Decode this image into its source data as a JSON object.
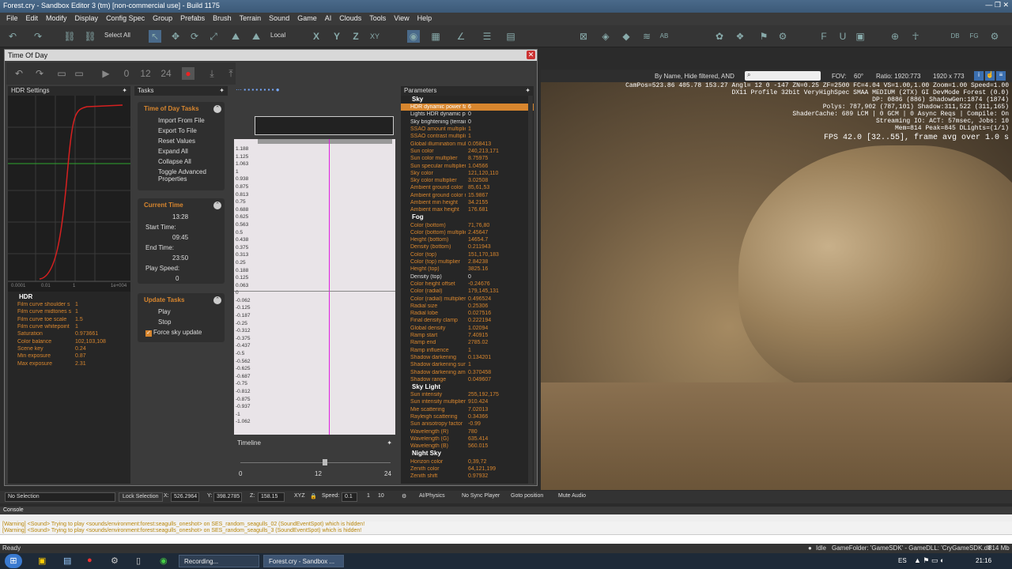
{
  "window": {
    "title": "Forest.cry - Sandbox Editor 3 (tm) [non-commercial use] - Build 1175"
  },
  "menu": [
    "File",
    "Edit",
    "Modify",
    "Display",
    "Config Spec",
    "Group",
    "Prefabs",
    "Brush",
    "Terrain",
    "Sound",
    "Game",
    "AI",
    "Clouds",
    "Tools",
    "View",
    "Help"
  ],
  "toolbar": {
    "select_all": "Select All",
    "coord_space": "Local",
    "axes": [
      "X",
      "Y",
      "Z",
      "XY"
    ]
  },
  "viewport_bar": {
    "filter": "By Name, Hide filtered, AND",
    "fov_label": "FOV:",
    "fov_value": "60°",
    "ratio_label": "Ratio: 1920:773",
    "resolution": "1920 x 773"
  },
  "tod": {
    "title": "Time Of Day",
    "hdr_panel": "HDR Settings",
    "graph_ticks": [
      "0.0001",
      "0.01",
      "1",
      "1e+004"
    ],
    "hdr_section": "HDR",
    "hdr_params": [
      {
        "label": "Film curve shoulder s",
        "value": "1"
      },
      {
        "label": "Film curve midtones s",
        "value": "1"
      },
      {
        "label": "Film curve toe scale",
        "value": "1.5"
      },
      {
        "label": "Film curve whitepoint",
        "value": "1"
      },
      {
        "label": "Saturation",
        "value": "0.973661"
      },
      {
        "label": "Color balance",
        "value": "102,103,108"
      },
      {
        "label": "Scene key",
        "value": "0.24"
      },
      {
        "label": "Min exposure",
        "value": "0.87"
      },
      {
        "label": "Max exposure",
        "value": "2.31"
      }
    ],
    "tasks_panel": "Tasks",
    "tod_tasks_title": "Time of Day Tasks",
    "tod_tasks": [
      "Import From File",
      "Export To File",
      "Reset Values",
      "Expand All",
      "Collapse All",
      "Toggle Advanced Properties"
    ],
    "current_time_title": "Current Time",
    "current_time": "13:28",
    "start_time_label": "Start Time:",
    "start_time": "09:45",
    "end_time_label": "End Time:",
    "end_time": "23:50",
    "play_speed_label": "Play Speed:",
    "play_speed": "0",
    "update_tasks_title": "Update Tasks",
    "update_tasks": [
      "Play",
      "Stop"
    ],
    "force_sky": "Force sky update",
    "toolbar_nums": [
      "0",
      "12",
      "24"
    ],
    "curve_ticks": [
      "1.188",
      "1.125",
      "1.063",
      "1",
      "0.938",
      "0.875",
      "0.813",
      "0.75",
      "0.688",
      "0.625",
      "0.563",
      "0.5",
      "0.438",
      "0.375",
      "0.313",
      "0.25",
      "0.188",
      "0.125",
      "0.063",
      "0",
      "-0.062",
      "-0.125",
      "-0.187",
      "-0.25",
      "-0.312",
      "-0.375",
      "-0.437",
      "-0.5",
      "-0.562",
      "-0.625",
      "-0.687",
      "-0.75",
      "-0.812",
      "-0.875",
      "-0.937",
      "-1",
      "-1.062"
    ],
    "timeline_label": "Timeline",
    "timeline_ticks": [
      "0",
      "12",
      "24"
    ],
    "params_panel": "Parameters",
    "sections": [
      {
        "name": "Sky",
        "params": [
          {
            "label": "HDR dynamic power fac",
            "value": "6"
          },
          {
            "label": "Lights HDR dynamic pow",
            "value": "0"
          },
          {
            "label": "Sky brightening (terrain",
            "value": "0"
          },
          {
            "label": "SSAO amount multiplier",
            "value": "1"
          },
          {
            "label": "SSAO contrast multiplier",
            "value": "1"
          },
          {
            "label": "Global illumination multip",
            "value": "0.058413"
          },
          {
            "label": "Sun color",
            "value": "240,213,171"
          },
          {
            "label": "Sun color multiplier",
            "value": "8.75975"
          },
          {
            "label": "Sun specular multiplier",
            "value": "1.04566"
          },
          {
            "label": "Sky color",
            "value": "121,120,110"
          },
          {
            "label": "Sky color multiplier",
            "value": "3.02508"
          },
          {
            "label": "Ambient ground color",
            "value": "85,61,53"
          },
          {
            "label": "Ambient ground color m",
            "value": "15.9867"
          },
          {
            "label": "Ambient min height",
            "value": "34.2155"
          },
          {
            "label": "Ambient max height",
            "value": "176.681"
          }
        ]
      },
      {
        "name": "Fog",
        "params": [
          {
            "label": "Color (bottom)",
            "value": "71,76,80"
          },
          {
            "label": "Color (bottom) multiplier",
            "value": "2.45647"
          },
          {
            "label": "Height (bottom)",
            "value": "14654.7"
          },
          {
            "label": "Density (bottom)",
            "value": "0.211943"
          },
          {
            "label": "Color (top)",
            "value": "151,170,183"
          },
          {
            "label": "Color (top) multiplier",
            "value": "2.84238"
          },
          {
            "label": "Height (top)",
            "value": "3825.16"
          },
          {
            "label": "Density (top)",
            "value": "0"
          },
          {
            "label": "Color height offset",
            "value": "-0.24676"
          },
          {
            "label": "Color (radial)",
            "value": "179,145,131"
          },
          {
            "label": "Color (radial) multiplier",
            "value": "0.496524"
          },
          {
            "label": "Radial size",
            "value": "0.25306"
          },
          {
            "label": "Radial lobe",
            "value": "0.027516"
          },
          {
            "label": "Final density clamp",
            "value": "0.222194"
          },
          {
            "label": "Global density",
            "value": "1.02094"
          },
          {
            "label": "Ramp start",
            "value": "7.40915"
          },
          {
            "label": "Ramp end",
            "value": "2785.02"
          },
          {
            "label": "Ramp influence",
            "value": "1"
          },
          {
            "label": "Shadow darkening",
            "value": "0.134201"
          },
          {
            "label": "Shadow darkening sun",
            "value": "1"
          },
          {
            "label": "Shadow darkening ambie",
            "value": "0.370458"
          },
          {
            "label": "Shadow range",
            "value": "0.049607"
          }
        ]
      },
      {
        "name": "Sky Light",
        "params": [
          {
            "label": "Sun intensity",
            "value": "255,192,175"
          },
          {
            "label": "Sun intensity multiplier",
            "value": "910.424"
          },
          {
            "label": "Mie scattering",
            "value": "7.02013"
          },
          {
            "label": "Rayleigh scattering",
            "value": "0.34366"
          },
          {
            "label": "Sun anisotropy factor",
            "value": "-0.99"
          },
          {
            "label": "Wavelength (R)",
            "value": "780"
          },
          {
            "label": "Wavelength (G)",
            "value": "635.414"
          },
          {
            "label": "Wavelength (B)",
            "value": "560.015"
          }
        ]
      },
      {
        "name": "Night Sky",
        "params": [
          {
            "label": "Horizon color",
            "value": "0,39,72"
          },
          {
            "label": "Zenith color",
            "value": "64,121,199"
          },
          {
            "label": "Zenith shift",
            "value": "0.97932"
          }
        ]
      }
    ]
  },
  "viewport_info": [
    "CamPos=523.86 405.78 153.27 Angl= 12  0 -147 ZN=0.25 ZF=2500 FC=4.04 VS=1.00,1.00 Zoom=1.00 Speed=1.00",
    "DX11 Profile 32bit VeryHighSpec SMAA MEDIUM (2TX) GI DevMode Forest (0.0)",
    "DP: 0886 (886) ShadowGen:1874 (1874)",
    "Polys: 787,902 (787,101) Shadow:311,522 (311,165)",
    "ShaderCache: 689 LCM | 0 GCM | 0 Async Reqs | Compile: On",
    "Streaming IO: ACT: 57msec, Jobs: 10",
    "Mem=814 Peak=845 DLights=(1/1)"
  ],
  "fps": "FPS 42.0 [32..55], frame avg over 1.0 s",
  "status": {
    "selection": "No Selection",
    "lock_selection": "Lock Selection",
    "x_label": "X:",
    "x": "526.2964",
    "y_label": "Y:",
    "y": "398.2785",
    "z_label": "Z:",
    "z": "158.15",
    "xyz": "XYZ",
    "speed_label": "Speed:",
    "speed": "0.1",
    "speed_presets": [
      "1",
      "10"
    ],
    "ai_physics": "AI/Physics",
    "no_sync": "No Sync Player",
    "goto": "Goto position",
    "mute": "Mute Audio"
  },
  "console": {
    "title": "Console",
    "lines": [
      "[Warning] <Sound> Trying to play <sounds/environment:forest:seagulls_oneshot> on SES_random_seagulls_02 (SoundEventSpot) which is hidden!",
      "[Warning] <Sound> Trying to play <sounds/environment:forest:seagulls_oneshot> on SES_random_seagulls_3 (SoundEventSpot) which is hidden!"
    ]
  },
  "bottom_status": {
    "ready": "Ready",
    "idle": "Idle",
    "game_folder": "GameFolder: 'GameSDK' - GameDLL: 'CryGameSDK.dll'",
    "mem": "814 Mb"
  },
  "taskbar": {
    "apps": [
      "Recording...",
      "Forest.cry - Sandbox ..."
    ],
    "lang": "ES",
    "clock": "21:16"
  }
}
